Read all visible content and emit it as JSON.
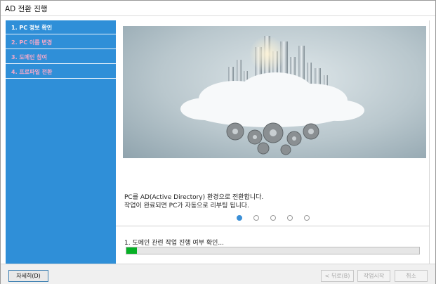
{
  "window": {
    "title": "AD 전환 진행"
  },
  "steps": [
    {
      "label": "1. PC 정보 확인",
      "state": "active"
    },
    {
      "label": "2. PC 이름 변경",
      "state": "pending"
    },
    {
      "label": "3. 도메인 참여",
      "state": "pending"
    },
    {
      "label": "4. 프로파일 전환",
      "state": "pending"
    }
  ],
  "description": {
    "line1": "PC를 AD(Active Directory) 환경으로 전환합니다.",
    "line2": "작업이 완료되면 PC가 자동으로 리부팅 됩니다."
  },
  "carousel": {
    "count": 5,
    "active_index": 0
  },
  "status": {
    "text": "1. 도메인 관련 작업 진행 여부 확인...",
    "progress_fraction": 0.035
  },
  "buttons": {
    "details": "자세히(D)",
    "back": "< 뒤로(B)",
    "start": "작업시작",
    "cancel": "취소"
  },
  "colors": {
    "sidebar": "#2f8fd8",
    "active_step_text": "#ffffff",
    "pending_step_text": "#f3a9c9",
    "progress_fill": "#06b025",
    "active_dot": "#3b8fd6"
  }
}
